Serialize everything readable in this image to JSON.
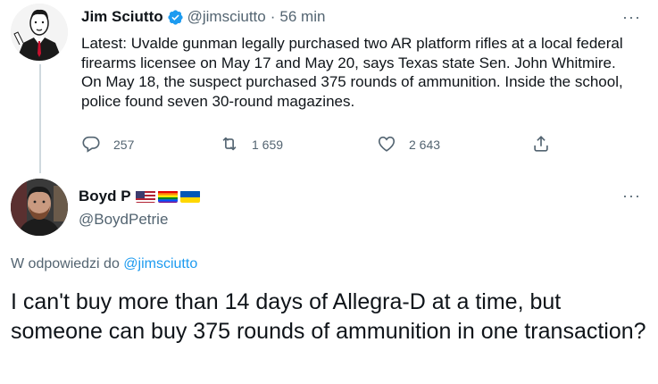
{
  "tweet1": {
    "name": "Jim Sciutto",
    "handle": "@jimsciutto",
    "separator": "·",
    "time": "56 min",
    "more": "···",
    "text": "Latest: Uvalde gunman legally purchased two AR platform rifles at a local federal firearms licensee on May 17 and May 20, says Texas state Sen. John Whitmire. On May 18, the suspect purchased 375 rounds of ammunition. Inside the school, police found seven 30-round magazines.",
    "replies": "257",
    "retweets": "1 659",
    "likes": "2 643"
  },
  "tweet2": {
    "name": "Boyd P",
    "handle": "@BoydPetrie",
    "more": "···",
    "reply_prefix": "W odpowiedzi do ",
    "reply_handle": "@jimsciutto",
    "text": "I can't buy more than 14 days of Allegra-D at a time, but someone can buy 375 rounds of ammunition in one transaction?"
  },
  "colors": {
    "accent": "#1d9bf0",
    "text_secondary": "#536471",
    "text_primary": "#0f1419",
    "thread_line": "#cfd9de"
  },
  "icons": {
    "verified": "verified-badge-icon",
    "reply": "reply-icon",
    "retweet": "retweet-icon",
    "like": "heart-icon",
    "share": "share-icon",
    "flags": [
      "us-flag-icon",
      "rainbow-flag-icon",
      "ukraine-flag-icon"
    ]
  }
}
